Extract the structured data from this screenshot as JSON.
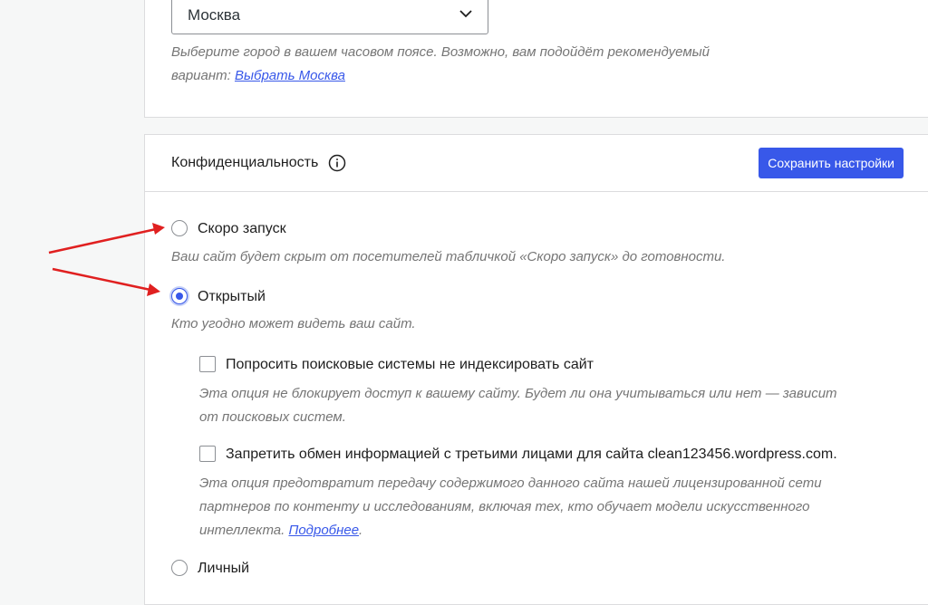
{
  "timezone": {
    "selected_value": "Москва",
    "help_text": "Выберите город в вашем часовом поясе. Возможно, вам подойдёт рекомендуемый вариант:",
    "suggest_link": "Выбрать Москва"
  },
  "privacy": {
    "title": "Конфиденциальность",
    "save_label": "Сохранить настройки",
    "options": [
      {
        "label": "Скоро запуск",
        "description": "Ваш сайт будет скрыт от посетителей табличкой «Скоро запуск» до готовности.",
        "checked": false
      },
      {
        "label": "Открытый",
        "description": "Кто угодно может видеть ваш сайт.",
        "checked": true
      },
      {
        "label": "Личный",
        "checked": false
      }
    ],
    "sub_options": [
      {
        "label": "Попросить поисковые системы не индексировать сайт",
        "description_line1": "Эта опция не блокирует доступ к вашему сайту. Будет ли она учитываться или нет — зависит",
        "description_line2": "от поисковых систем.",
        "checked": false
      },
      {
        "label": "Запретить обмен информацией с третьими лицами для сайта clean123456.wordpress.com.",
        "description_line1": "Эта опция предотвратит передачу содержимого данного сайта нашей лицензированной сети",
        "description_line2": "партнеров по контенту и исследованиям, включая тех, кто обучает модели искусственного",
        "description_line3": "интеллекта.",
        "link": "Подробнее",
        "after_link": ".",
        "checked": false
      }
    ]
  },
  "colors": {
    "accent": "#3858e9",
    "annotation_arrow": "#e02020"
  },
  "icons": [
    "chevron-down-icon",
    "info-icon"
  ]
}
